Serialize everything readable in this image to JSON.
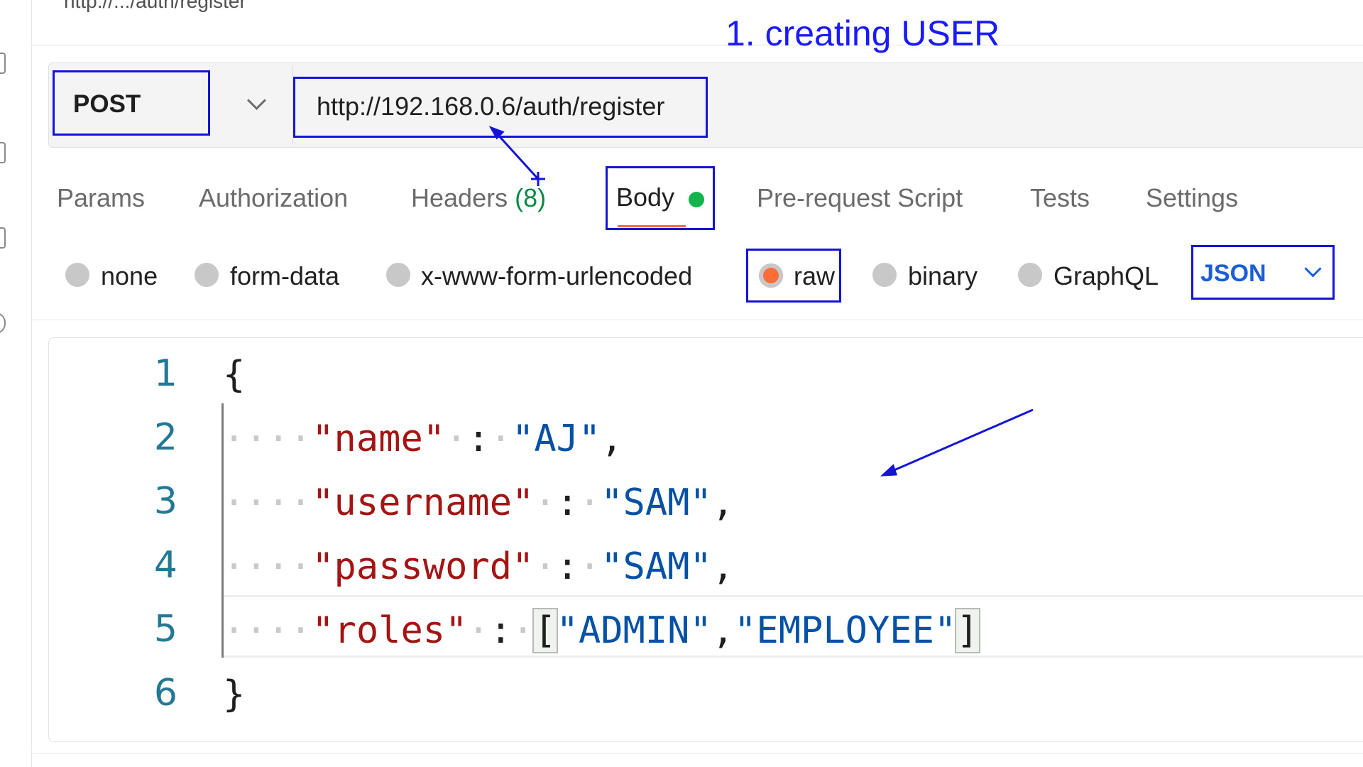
{
  "url_fragment": "http://.../auth/register",
  "annotation_title": "1. creating USER",
  "request": {
    "method": "POST",
    "url": "http://192.168.0.6/auth/register"
  },
  "tabs": [
    {
      "label": "Params"
    },
    {
      "label": "Authorization"
    },
    {
      "label": "Headers",
      "count": "(8)"
    },
    {
      "label": "Body",
      "active": true
    },
    {
      "label": "Pre-request Script"
    },
    {
      "label": "Tests"
    },
    {
      "label": "Settings"
    }
  ],
  "body_types": [
    {
      "label": "none",
      "selected": false
    },
    {
      "label": "form-data",
      "selected": false
    },
    {
      "label": "x-www-form-urlencoded",
      "selected": false
    },
    {
      "label": "raw",
      "selected": true
    },
    {
      "label": "binary",
      "selected": false
    },
    {
      "label": "GraphQL",
      "selected": false
    }
  ],
  "format_dropdown": {
    "value": "JSON"
  },
  "editor": {
    "line_numbers": [
      "1",
      "2",
      "3",
      "4",
      "5",
      "6"
    ],
    "open_brace": "{",
    "close_brace": "}",
    "lines": [
      {
        "key": "\"name\"",
        "value": "\"AJ\"",
        "trail": ","
      },
      {
        "key": "\"username\"",
        "value": "\"SAM\"",
        "trail": ","
      },
      {
        "key": "\"password\"",
        "value": "\"SAM\"",
        "trail": ","
      },
      {
        "key": "\"roles\"",
        "array": [
          "\"ADMIN\"",
          "\"EMPLOYEE\""
        ]
      }
    ]
  },
  "colors": {
    "annotation": "#1414d8",
    "active_tab_indicator": "#10b44c",
    "selected_radio": "#ff6c37",
    "json_key": "#a31515",
    "json_value": "#0451a5"
  }
}
